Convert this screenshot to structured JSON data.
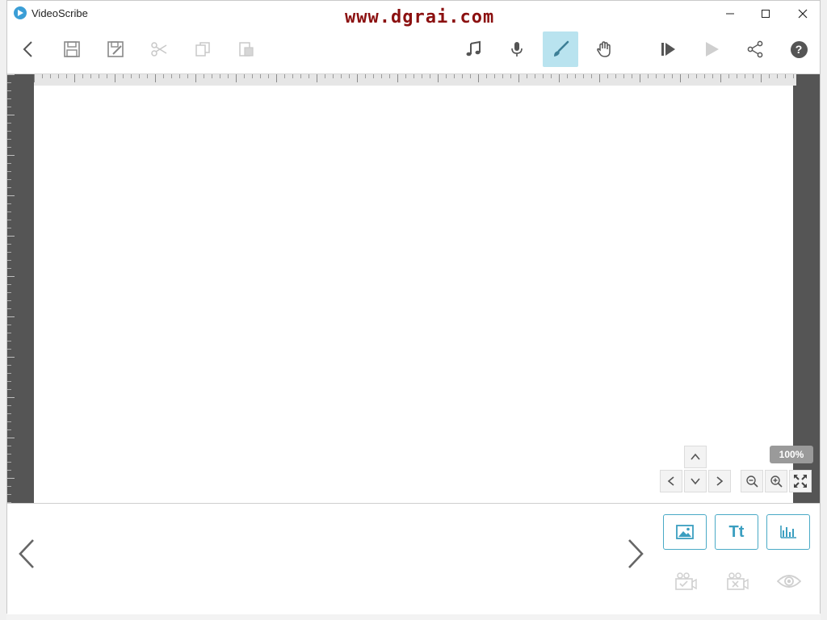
{
  "app": {
    "title": "VideoScribe",
    "watermark": "www.dgrai.com"
  },
  "window_controls": {
    "minimize": "minimize-icon",
    "maximize": "maximize-icon",
    "close": "close-icon"
  },
  "toolbar": {
    "items": [
      "back-icon",
      "save-icon",
      "save-as-icon",
      "cut-icon",
      "copy-icon",
      "paste-icon",
      "music-icon",
      "microphone-icon",
      "brush-icon",
      "hand-icon",
      "preview-from-icon",
      "play-icon",
      "share-icon",
      "help-icon"
    ],
    "active": "brush-icon",
    "help_label": "?"
  },
  "canvas": {
    "zoom_label": "100%"
  },
  "bottom": {
    "text_button_label": "Tt",
    "add_buttons": [
      "image-icon",
      "text-icon",
      "chart-icon"
    ],
    "secondary": [
      "camera-check-icon",
      "camera-cross-icon",
      "eye-icon"
    ]
  },
  "colors": {
    "accent": "#4aaac6",
    "active_bg": "#b9e3ef",
    "stage": "#555555",
    "watermark": "#8b1010"
  }
}
